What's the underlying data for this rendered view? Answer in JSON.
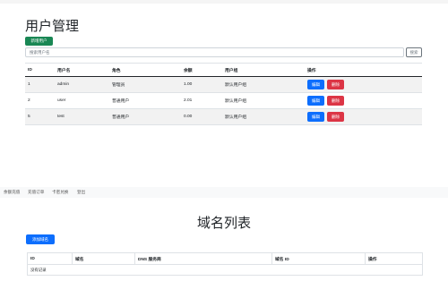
{
  "users_section": {
    "title": "用户管理",
    "add_button": "新增用户",
    "search": {
      "placeholder": "搜索用户名",
      "button": "搜索"
    },
    "columns": [
      "ID",
      "用户名",
      "角色",
      "余额",
      "用户组",
      "操作"
    ],
    "rows": [
      {
        "id": "1",
        "username": "admin",
        "role": "管理员",
        "balance": "1.00",
        "group": "默认用户组",
        "edit": "编辑",
        "delete": "删除"
      },
      {
        "id": "2",
        "username": "user",
        "role": "普通用户",
        "balance": "2.01",
        "group": "默认用户组",
        "edit": "编辑",
        "delete": "删除"
      },
      {
        "id": "5",
        "username": "test",
        "role": "普通用户",
        "balance": "0.00",
        "group": "默认用户组",
        "edit": "编辑",
        "delete": "删除"
      }
    ]
  },
  "nav": {
    "items": [
      "余额充值",
      "充值订单",
      "卡密兑换",
      "登出"
    ]
  },
  "domains_section": {
    "title": "域名列表",
    "add_button": "添加域名",
    "columns": [
      "ID",
      "域名",
      "DNS 服务商",
      "域名 ID",
      "操作"
    ],
    "empty_text": "没有记录"
  },
  "colors": {
    "primary": "#0d6efd",
    "success": "#198754",
    "danger": "#dc3545"
  }
}
